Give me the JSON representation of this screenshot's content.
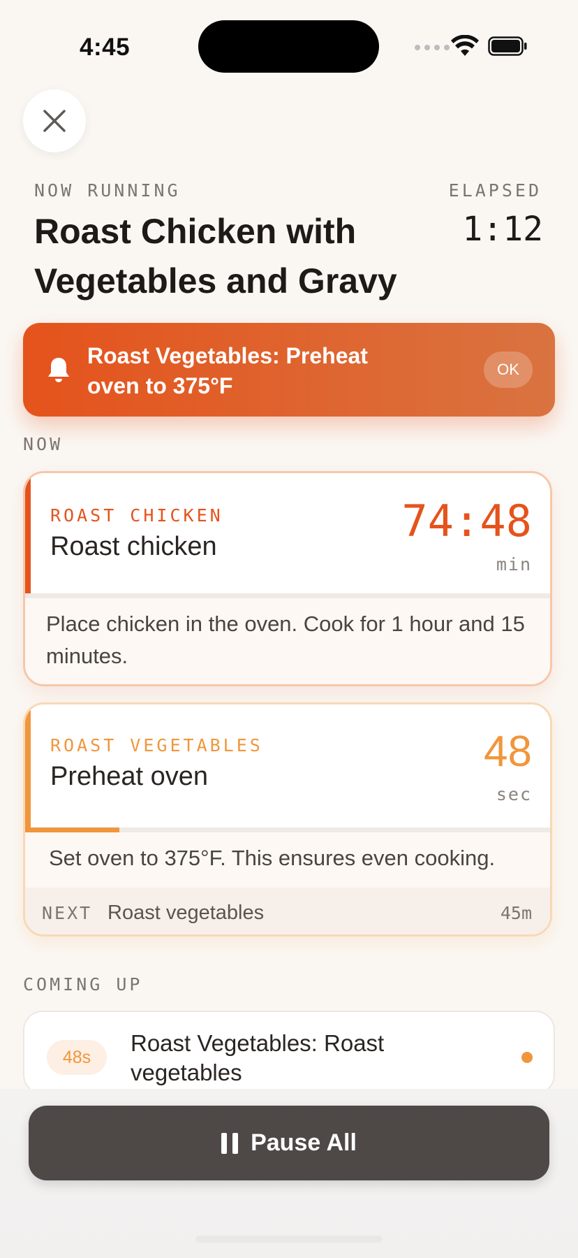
{
  "status_bar": {
    "time": "4:45"
  },
  "header": {
    "now_running_label": "NOW RUNNING",
    "title": "Roast Chicken with Vegetables and Gravy",
    "elapsed_label": "ELAPSED",
    "elapsed_value": "1:12"
  },
  "alert": {
    "text": "Roast Vegetables: Preheat oven to 375°F",
    "ok_label": "OK"
  },
  "now_section": {
    "label": "NOW",
    "steps": [
      {
        "category": "ROAST CHICKEN",
        "name": "Roast chicken",
        "timer": "74:48",
        "unit": "min",
        "description": "Place chicken in the oven. Cook for 1 hour and 15 minutes.",
        "progress": 0.0,
        "accent_color": "#E5531C"
      },
      {
        "category": "ROAST VEGETABLES",
        "name": "Preheat oven",
        "timer": "48",
        "unit": "sec",
        "description": "Set oven to 375°F. This ensures even cooking.",
        "progress": 0.18,
        "accent_color": "#F0963C",
        "next": {
          "label": "NEXT",
          "name": "Roast vegetables",
          "duration": "45m"
        }
      }
    ]
  },
  "coming_up": {
    "label": "COMING UP",
    "items": [
      {
        "badge": "48s",
        "title": "Roast Vegetables: Roast vegetables",
        "dot_color": "#F0963C"
      }
    ]
  },
  "footer": {
    "pause_all_label": "Pause All"
  },
  "icons": {
    "close": "close-icon",
    "bell": "bell-icon",
    "wifi": "wifi-icon",
    "battery": "battery-icon",
    "pause": "pause-icon"
  }
}
